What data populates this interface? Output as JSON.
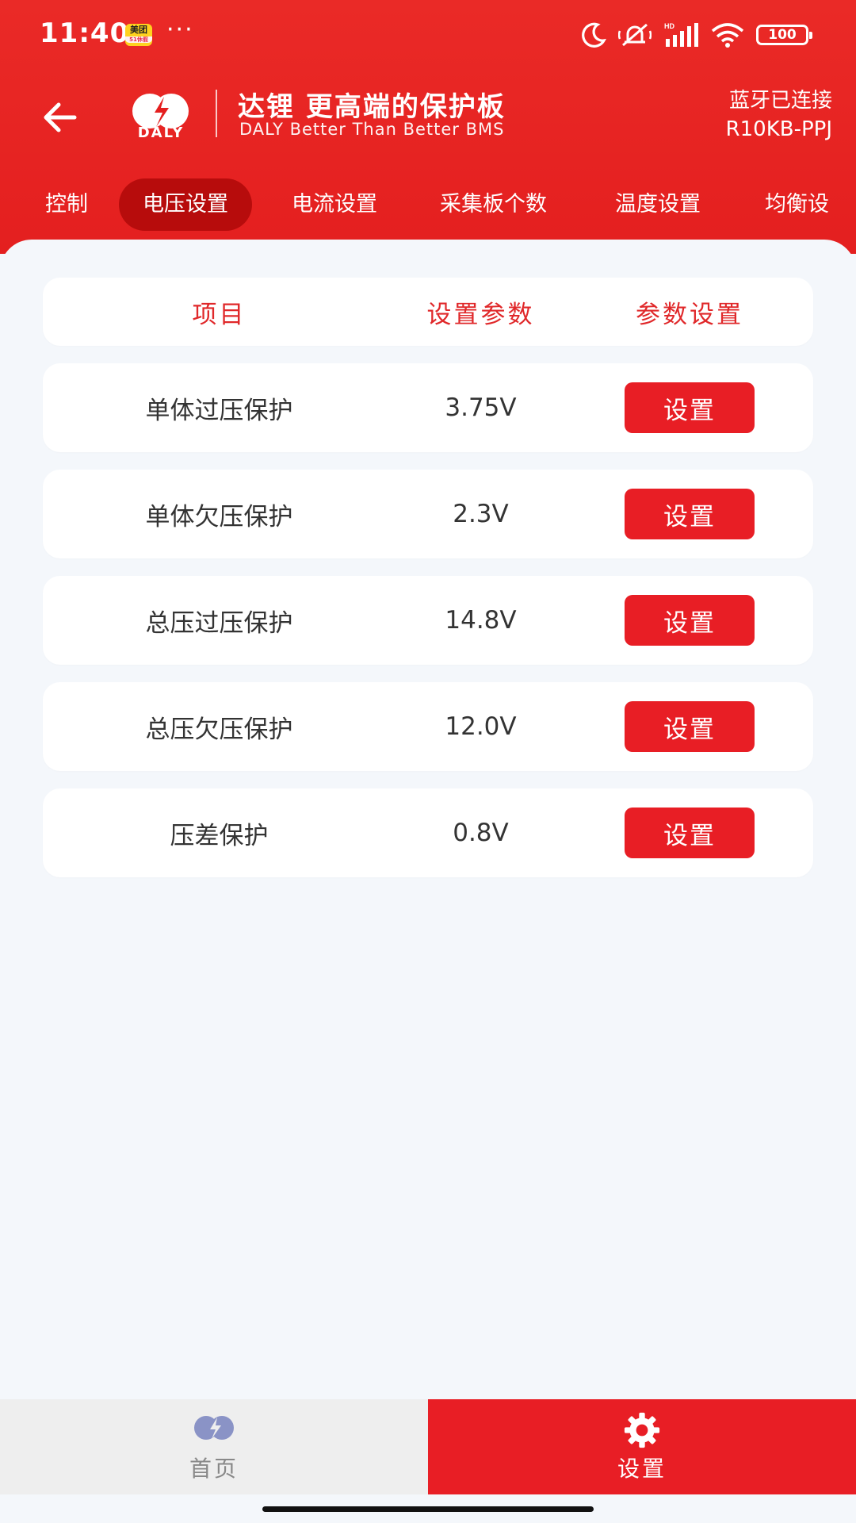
{
  "status_bar": {
    "time": "11:40",
    "app_badge": "美团",
    "app_badge_sub": "51休假",
    "more": "···",
    "battery": "100"
  },
  "app_bar": {
    "logo_text": "DALY",
    "brand_title": "达锂 更高端的保护板",
    "brand_subtitle": "DALY Better Than Better BMS",
    "bluetooth_status": "蓝牙已连接",
    "device_name": "R10KB-PPJ"
  },
  "tabs": [
    {
      "label": "控制",
      "active": false
    },
    {
      "label": "电压设置",
      "active": true
    },
    {
      "label": "电流设置",
      "active": false
    },
    {
      "label": "采集板个数",
      "active": false
    },
    {
      "label": "温度设置",
      "active": false
    },
    {
      "label": "均衡设",
      "active": false
    }
  ],
  "table": {
    "headers": [
      "项目",
      "设置参数",
      "参数设置"
    ],
    "rows": [
      {
        "item": "单体过压保护",
        "value": "3.75V",
        "action": "设置"
      },
      {
        "item": "单体欠压保护",
        "value": "2.3V",
        "action": "设置"
      },
      {
        "item": "总压过压保护",
        "value": "14.8V",
        "action": "设置"
      },
      {
        "item": "总压欠压保护",
        "value": "12.0V",
        "action": "设置"
      },
      {
        "item": "压差保护",
        "value": "0.8V",
        "action": "设置"
      }
    ]
  },
  "bottom_nav": {
    "home_label": "首页",
    "settings_label": "设置",
    "active": "settings"
  },
  "colors": {
    "primary": "#e81e25",
    "tab_active": "#b70c0c",
    "background": "#f4f7fb"
  }
}
